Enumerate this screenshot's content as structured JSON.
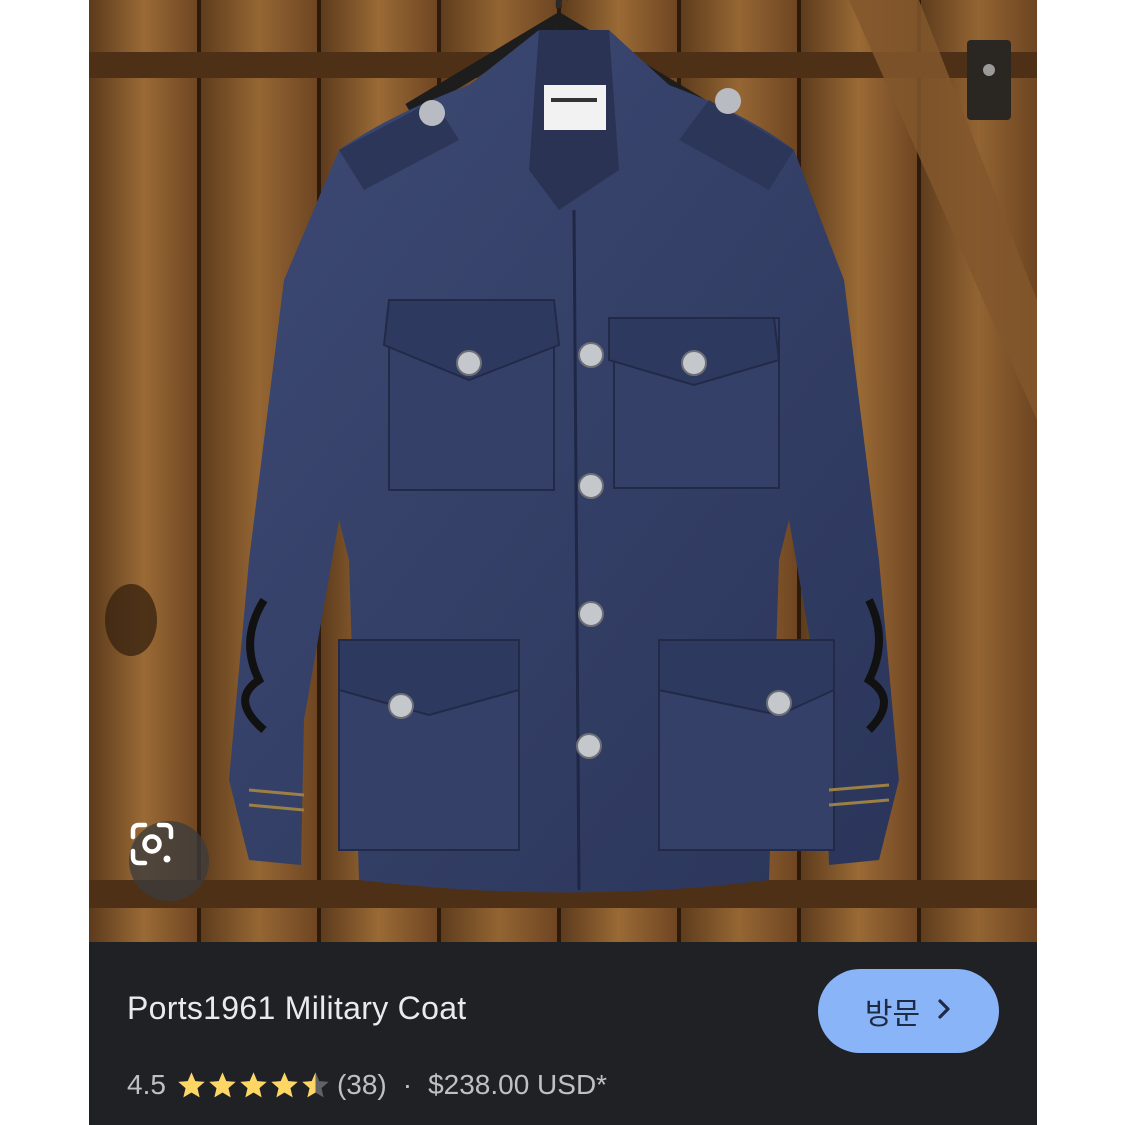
{
  "product": {
    "title": "Ports1961 Military Coat",
    "rating": "4.5",
    "rating_value": 4.5,
    "rating_max": 5,
    "review_count": "(38)",
    "separator": "·",
    "price": "$238.00 USD*"
  },
  "visit_button": {
    "label": "방문",
    "icon": "chevron-right-icon"
  },
  "lens_button": {
    "icon": "google-lens-icon"
  },
  "image": {
    "icons": [
      "hanger-icon",
      "garment-label-icon"
    ]
  },
  "colors": {
    "panel_bg": "#202124",
    "button_bg": "#8ab4f8",
    "star": "#fdd663",
    "text_primary": "#e8eaed",
    "text_secondary": "#bdc1c6"
  }
}
